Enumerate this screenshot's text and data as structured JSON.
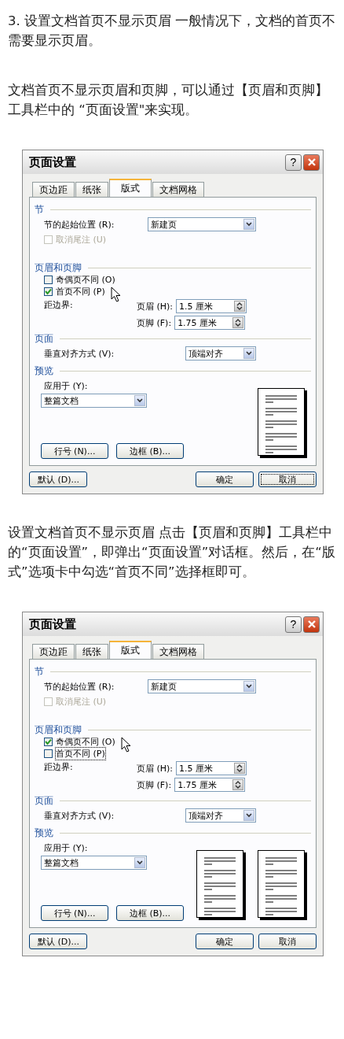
{
  "content": [
    {
      "kind": "paragraph",
      "text": "3. 设置文档首页不显示页眉 一般情况下，文档的首页不需要显示页眉。"
    },
    {
      "kind": "paragraph",
      "text": "文档首页不显示页眉和页脚，可以通过【页眉和页脚】工具栏中的 “页面设置\"来实现。"
    },
    {
      "kind": "dialog",
      "title": "页面设置",
      "help": "?",
      "tabs": [
        {
          "label": "页边距",
          "selected": false
        },
        {
          "label": "纸张",
          "selected": false
        },
        {
          "label": "版式",
          "selected": true
        },
        {
          "label": "文档网格",
          "selected": false
        }
      ],
      "section": {
        "heading": "节",
        "start_label": "节的起始位置 (R):",
        "start_value": "新建页",
        "endnote": {
          "label": "取消尾注 (U)",
          "checked": false,
          "disabled": true
        }
      },
      "header_footer": {
        "heading": "页眉和页脚",
        "options": [
          {
            "label": "奇偶页不同 (O)",
            "checked": false,
            "focused": false,
            "pointer": false
          },
          {
            "label": "首页不同 (P)",
            "checked": true,
            "focused": false,
            "pointer": true
          }
        ],
        "distance_label": "距边界:",
        "spinners": [
          {
            "label": "页眉 (H):",
            "value": "1.5 厘米"
          },
          {
            "label": "页脚 (F):",
            "value": "1.75 厘米"
          }
        ]
      },
      "page": {
        "heading": "页面",
        "align_label": "垂直对齐方式 (V):",
        "align_value": "顶端对齐"
      },
      "preview": {
        "heading": "预览",
        "apply_label": "应用于 (Y):",
        "apply_value": "整篇文档",
        "pages": [
          {
            "kind": "page"
          }
        ],
        "buttons": [
          "行号 (N)...",
          "边框 (B)..."
        ]
      },
      "footer_buttons": [
        {
          "label": "默认 (D)...",
          "kind": "left",
          "focused": false
        },
        {
          "label": "确定",
          "kind": "right",
          "focused": false
        },
        {
          "label": "取消",
          "kind": "right",
          "focused": true
        }
      ]
    },
    {
      "kind": "paragraph",
      "text": "设置文档首页不显示页眉 点击【页眉和页脚】工具栏中的“页面设置”，即弹出“页面设置”对话框。然后，在“版式”选项卡中勾选“首页不同”选择框即可。"
    },
    {
      "kind": "dialog",
      "title": "页面设置",
      "help": "?",
      "tabs": [
        {
          "label": "页边距",
          "selected": false
        },
        {
          "label": "纸张",
          "selected": false
        },
        {
          "label": "版式",
          "selected": true
        },
        {
          "label": "文档网格",
          "selected": false
        }
      ],
      "section": {
        "heading": "节",
        "start_label": "节的起始位置 (R):",
        "start_value": "新建页",
        "endnote": {
          "label": "取消尾注 (U)",
          "checked": false,
          "disabled": true
        }
      },
      "header_footer": {
        "heading": "页眉和页脚",
        "options": [
          {
            "label": "奇偶页不同 (O)",
            "checked": true,
            "focused": false,
            "pointer": true
          },
          {
            "label": "首页不同 (P)",
            "checked": false,
            "focused": true,
            "pointer": false
          }
        ],
        "distance_label": "距边界:",
        "spinners": [
          {
            "label": "页眉 (H):",
            "value": "1.5 厘米"
          },
          {
            "label": "页脚 (F):",
            "value": "1.75 厘米"
          }
        ]
      },
      "page": {
        "heading": "页面",
        "align_label": "垂直对齐方式 (V):",
        "align_value": "顶端对齐"
      },
      "preview": {
        "heading": "预览",
        "apply_label": "应用于 (Y):",
        "apply_value": "整篇文档",
        "pages": [
          {
            "kind": "page"
          },
          {
            "kind": "page"
          }
        ],
        "buttons": [
          "行号 (N)...",
          "边框 (B)..."
        ]
      },
      "footer_buttons": [
        {
          "label": "默认 (D)...",
          "kind": "left",
          "focused": false
        },
        {
          "label": "确定",
          "kind": "right",
          "focused": false
        },
        {
          "label": "取消",
          "kind": "right",
          "focused": false
        }
      ]
    }
  ]
}
